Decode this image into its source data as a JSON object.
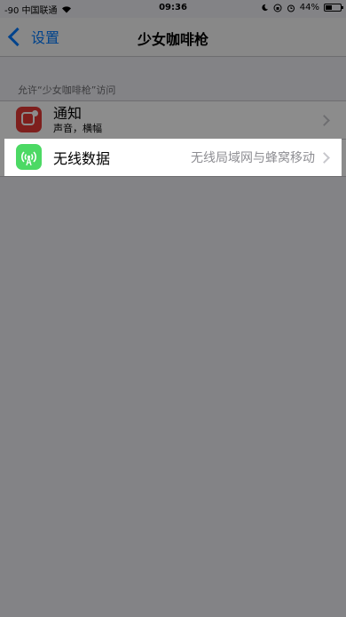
{
  "status_bar": {
    "carrier": "-90 中国联通",
    "wifi_icon": "wifi-icon",
    "time": "09:36",
    "right_icons": [
      "moon-icon",
      "lock-rotation-icon",
      "alarm-icon"
    ],
    "battery": "44%",
    "battery_level": 0.44
  },
  "nav": {
    "back_label": "设置",
    "title": "少女咖啡枪"
  },
  "section": {
    "header": "允许“少女咖啡枪”访问"
  },
  "rows": [
    {
      "icon": "notification-app-icon",
      "title": "通知",
      "subtitle": "声音，横幅"
    },
    {
      "icon": "wireless-data-app-icon",
      "title": "无线数据",
      "value": "无线局域网与蜂窝移动"
    }
  ],
  "colors": {
    "accent": "#007aff",
    "notification_icon": "#e53935",
    "wireless_icon": "#4cd964",
    "overlay": "rgba(0,0,0,0.45)"
  }
}
